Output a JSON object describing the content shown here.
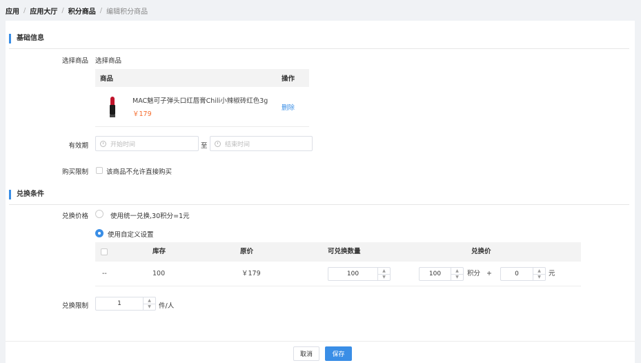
{
  "breadcrumb": {
    "items": [
      "应用",
      "应用大厅",
      "积分商品",
      "编辑积分商品"
    ],
    "separator": "/"
  },
  "basic_section": {
    "title": "基础信息"
  },
  "goods": {
    "label": "选择商品",
    "select_link": "选择商品",
    "table": {
      "col_goods": "商品",
      "col_ops": "操作",
      "row": {
        "name": "MAC魅可子弹头口红唇膏Chili小辣椒砖红色3g",
        "price": "￥179",
        "delete": "删除"
      }
    }
  },
  "validity": {
    "label": "有效期",
    "start_placeholder": "开始时间",
    "separator": "至",
    "end_placeholder": "结束时间"
  },
  "purchase_limit": {
    "label": "购买限制",
    "checkbox_text": "该商品不允许直接购买"
  },
  "exchange_section": {
    "title": "兑换条件"
  },
  "exchange_price": {
    "label": "兑换价格",
    "option_unified": "使用统一兑换,30积分=1元",
    "option_custom": "使用自定义设置",
    "selected": "custom"
  },
  "exchange_table": {
    "headers": {
      "stock": "库存",
      "price": "原价",
      "qty": "可兑换数量",
      "exchange": "兑换价"
    },
    "row": {
      "sku": "--",
      "stock": "100",
      "price": "￥179",
      "qty": "100",
      "points": "100",
      "points_unit": "积分",
      "plus": "+",
      "cash": "0",
      "cash_unit": "元"
    }
  },
  "exchange_limit": {
    "label": "兑换限制",
    "value": "1",
    "unit": "件/人"
  },
  "footer": {
    "cancel": "取消",
    "save": "保存"
  },
  "colors": {
    "accent": "#3a8ee6",
    "price": "#f56c2c"
  }
}
